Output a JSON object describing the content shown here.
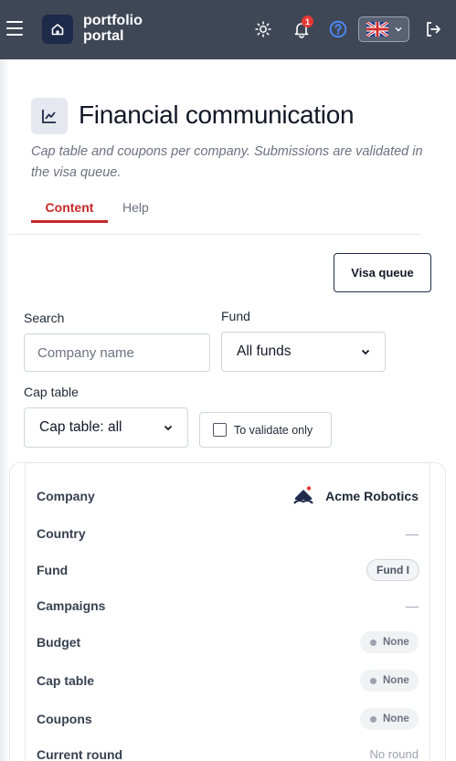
{
  "topbar": {
    "brand_line1": "portfolio",
    "brand_line2": "portal",
    "notification_count": "1",
    "icons": [
      "menu-icon",
      "home-icon",
      "sun-icon",
      "bell-icon",
      "help-icon",
      "uk-flag-icon",
      "logout-icon"
    ],
    "colors": {
      "bar": "#3f4756",
      "badge": "#e53935",
      "help": "#4f8cff"
    }
  },
  "header": {
    "title": "Financial communication",
    "subtitle": "Cap table and coupons per company. Submissions are validated in the visa queue.",
    "tabs": [
      {
        "label": "Content",
        "active": true
      },
      {
        "label": "Help",
        "active": false
      }
    ],
    "accent": "#c62828"
  },
  "actions": {
    "visa_queue": "Visa queue"
  },
  "filters": {
    "search_label": "Search",
    "search_placeholder": "Company name",
    "search_value": "",
    "fund_label": "Fund",
    "fund_selected": "All funds",
    "cap_label": "Cap table",
    "cap_selected": "Cap table: all",
    "validate_only_label": "To validate only",
    "validate_only_checked": false
  },
  "card": {
    "labels": {
      "company": "Company",
      "country": "Country",
      "fund": "Fund",
      "campaigns": "Campaigns",
      "budget": "Budget",
      "cap_table": "Cap table",
      "coupons": "Coupons",
      "current_round": "Current round"
    },
    "values": {
      "company": "Acme Robotics",
      "country": "—",
      "fund": "Fund I",
      "campaigns": "—",
      "budget": "None",
      "cap_table": "None",
      "coupons": "None",
      "current_round": "No round"
    }
  }
}
